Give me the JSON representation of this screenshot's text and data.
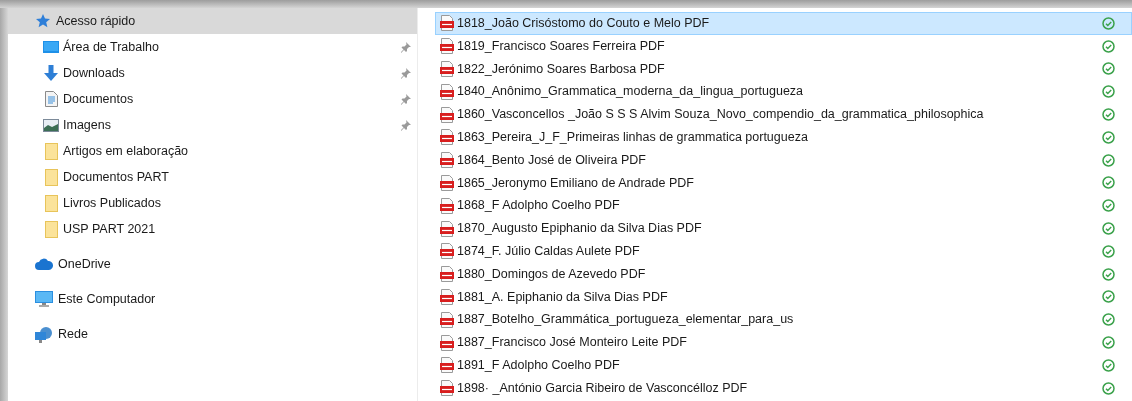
{
  "sidebar": {
    "sections": [
      {
        "label": "Acesso rápido",
        "kind": "quick_access",
        "selected": true,
        "children": [
          {
            "label": "Área de Trabalho",
            "kind": "desktop",
            "pinned": true
          },
          {
            "label": "Downloads",
            "kind": "downloads",
            "pinned": true
          },
          {
            "label": "Documentos",
            "kind": "documents",
            "pinned": true
          },
          {
            "label": "Imagens",
            "kind": "pictures",
            "pinned": true
          },
          {
            "label": "Artigos em elaboração",
            "kind": "folder",
            "pinned": false
          },
          {
            "label": "Documentos PART",
            "kind": "folder",
            "pinned": false
          },
          {
            "label": "Livros Publicados",
            "kind": "folder",
            "pinned": false
          },
          {
            "label": "USP PART 2021",
            "kind": "folder",
            "pinned": false
          }
        ]
      },
      {
        "label": "OneDrive",
        "kind": "onedrive",
        "selected": false
      },
      {
        "label": "Este Computador",
        "kind": "computer",
        "selected": false
      },
      {
        "label": "Rede",
        "kind": "network",
        "selected": false
      }
    ]
  },
  "files": [
    {
      "name": "1818_João Crisóstomo do Couto e Melo PDF",
      "selected": true,
      "synced": true
    },
    {
      "name": "1819_Francisco Soares Ferreira PDF",
      "selected": false,
      "synced": true
    },
    {
      "name": "1822_Jerónimo Soares Barbosa PDF",
      "selected": false,
      "synced": true
    },
    {
      "name": "1840_Anônimo_Grammatica_moderna_da_lingua_portugueza",
      "selected": false,
      "synced": true
    },
    {
      "name": "1860_Vasconcellos _João S S S Alvim Souza_Novo_compendio_da_grammatica_philosophica",
      "selected": false,
      "synced": true
    },
    {
      "name": "1863_Pereira_J_F_Primeiras linhas de grammatica portugueza",
      "selected": false,
      "synced": true
    },
    {
      "name": "1864_Bento José de Oliveira PDF",
      "selected": false,
      "synced": true
    },
    {
      "name": "1865_Jeronymo Emiliano de Andrade PDF",
      "selected": false,
      "synced": true
    },
    {
      "name": "1868_F Adolpho Coelho PDF",
      "selected": false,
      "synced": true
    },
    {
      "name": "1870_Augusto Epiphanio da Silva Dias PDF",
      "selected": false,
      "synced": true
    },
    {
      "name": "1874_F. Júlio Caldas Aulete PDF",
      "selected": false,
      "synced": true
    },
    {
      "name": "1880_Domingos de Azevedo PDF",
      "selected": false,
      "synced": true
    },
    {
      "name": "1881_A. Epiphanio da Silva Dias PDF",
      "selected": false,
      "synced": true
    },
    {
      "name": "1887_Botelho_Grammática_portugueza_elementar_para_us",
      "selected": false,
      "synced": true
    },
    {
      "name": "1887_Francisco José Monteiro Leite PDF",
      "selected": false,
      "synced": true
    },
    {
      "name": "1891_F Adolpho Coelho PDF",
      "selected": false,
      "synced": true
    },
    {
      "name": "1898· _António Garcia Ribeiro de Vasconcélloz PDF",
      "selected": false,
      "synced": true
    }
  ]
}
